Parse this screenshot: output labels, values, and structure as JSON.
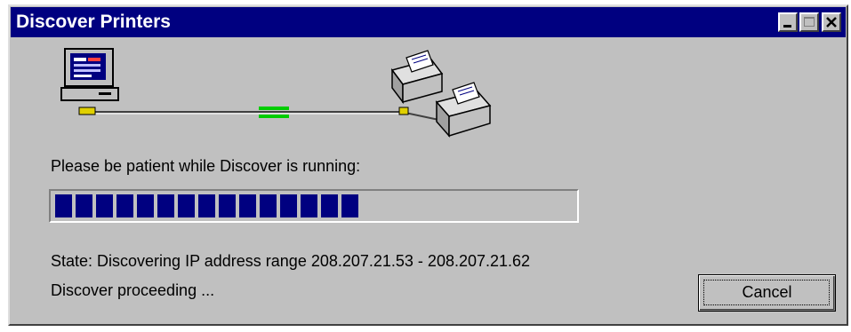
{
  "window": {
    "title": "Discover Printers",
    "controls": {
      "minimize_icon": "minimize-icon",
      "maximize_icon": "maximize-icon",
      "close_icon": "close-icon"
    }
  },
  "illustration": {
    "computer_icon": "computer-icon",
    "printer_icons": [
      "printer-icon",
      "printer-icon"
    ],
    "activity_color": "#00cc00"
  },
  "main": {
    "message": "Please be patient while Discover is running:",
    "progress": {
      "fraction": 0.6,
      "segments_filled": 15,
      "color": "#000080"
    },
    "state_text": "State:  Discovering IP address range 208.207.21.53 - 208.207.21.62",
    "status_text": "Discover proceeding ..."
  },
  "buttons": {
    "cancel_label": "Cancel"
  }
}
